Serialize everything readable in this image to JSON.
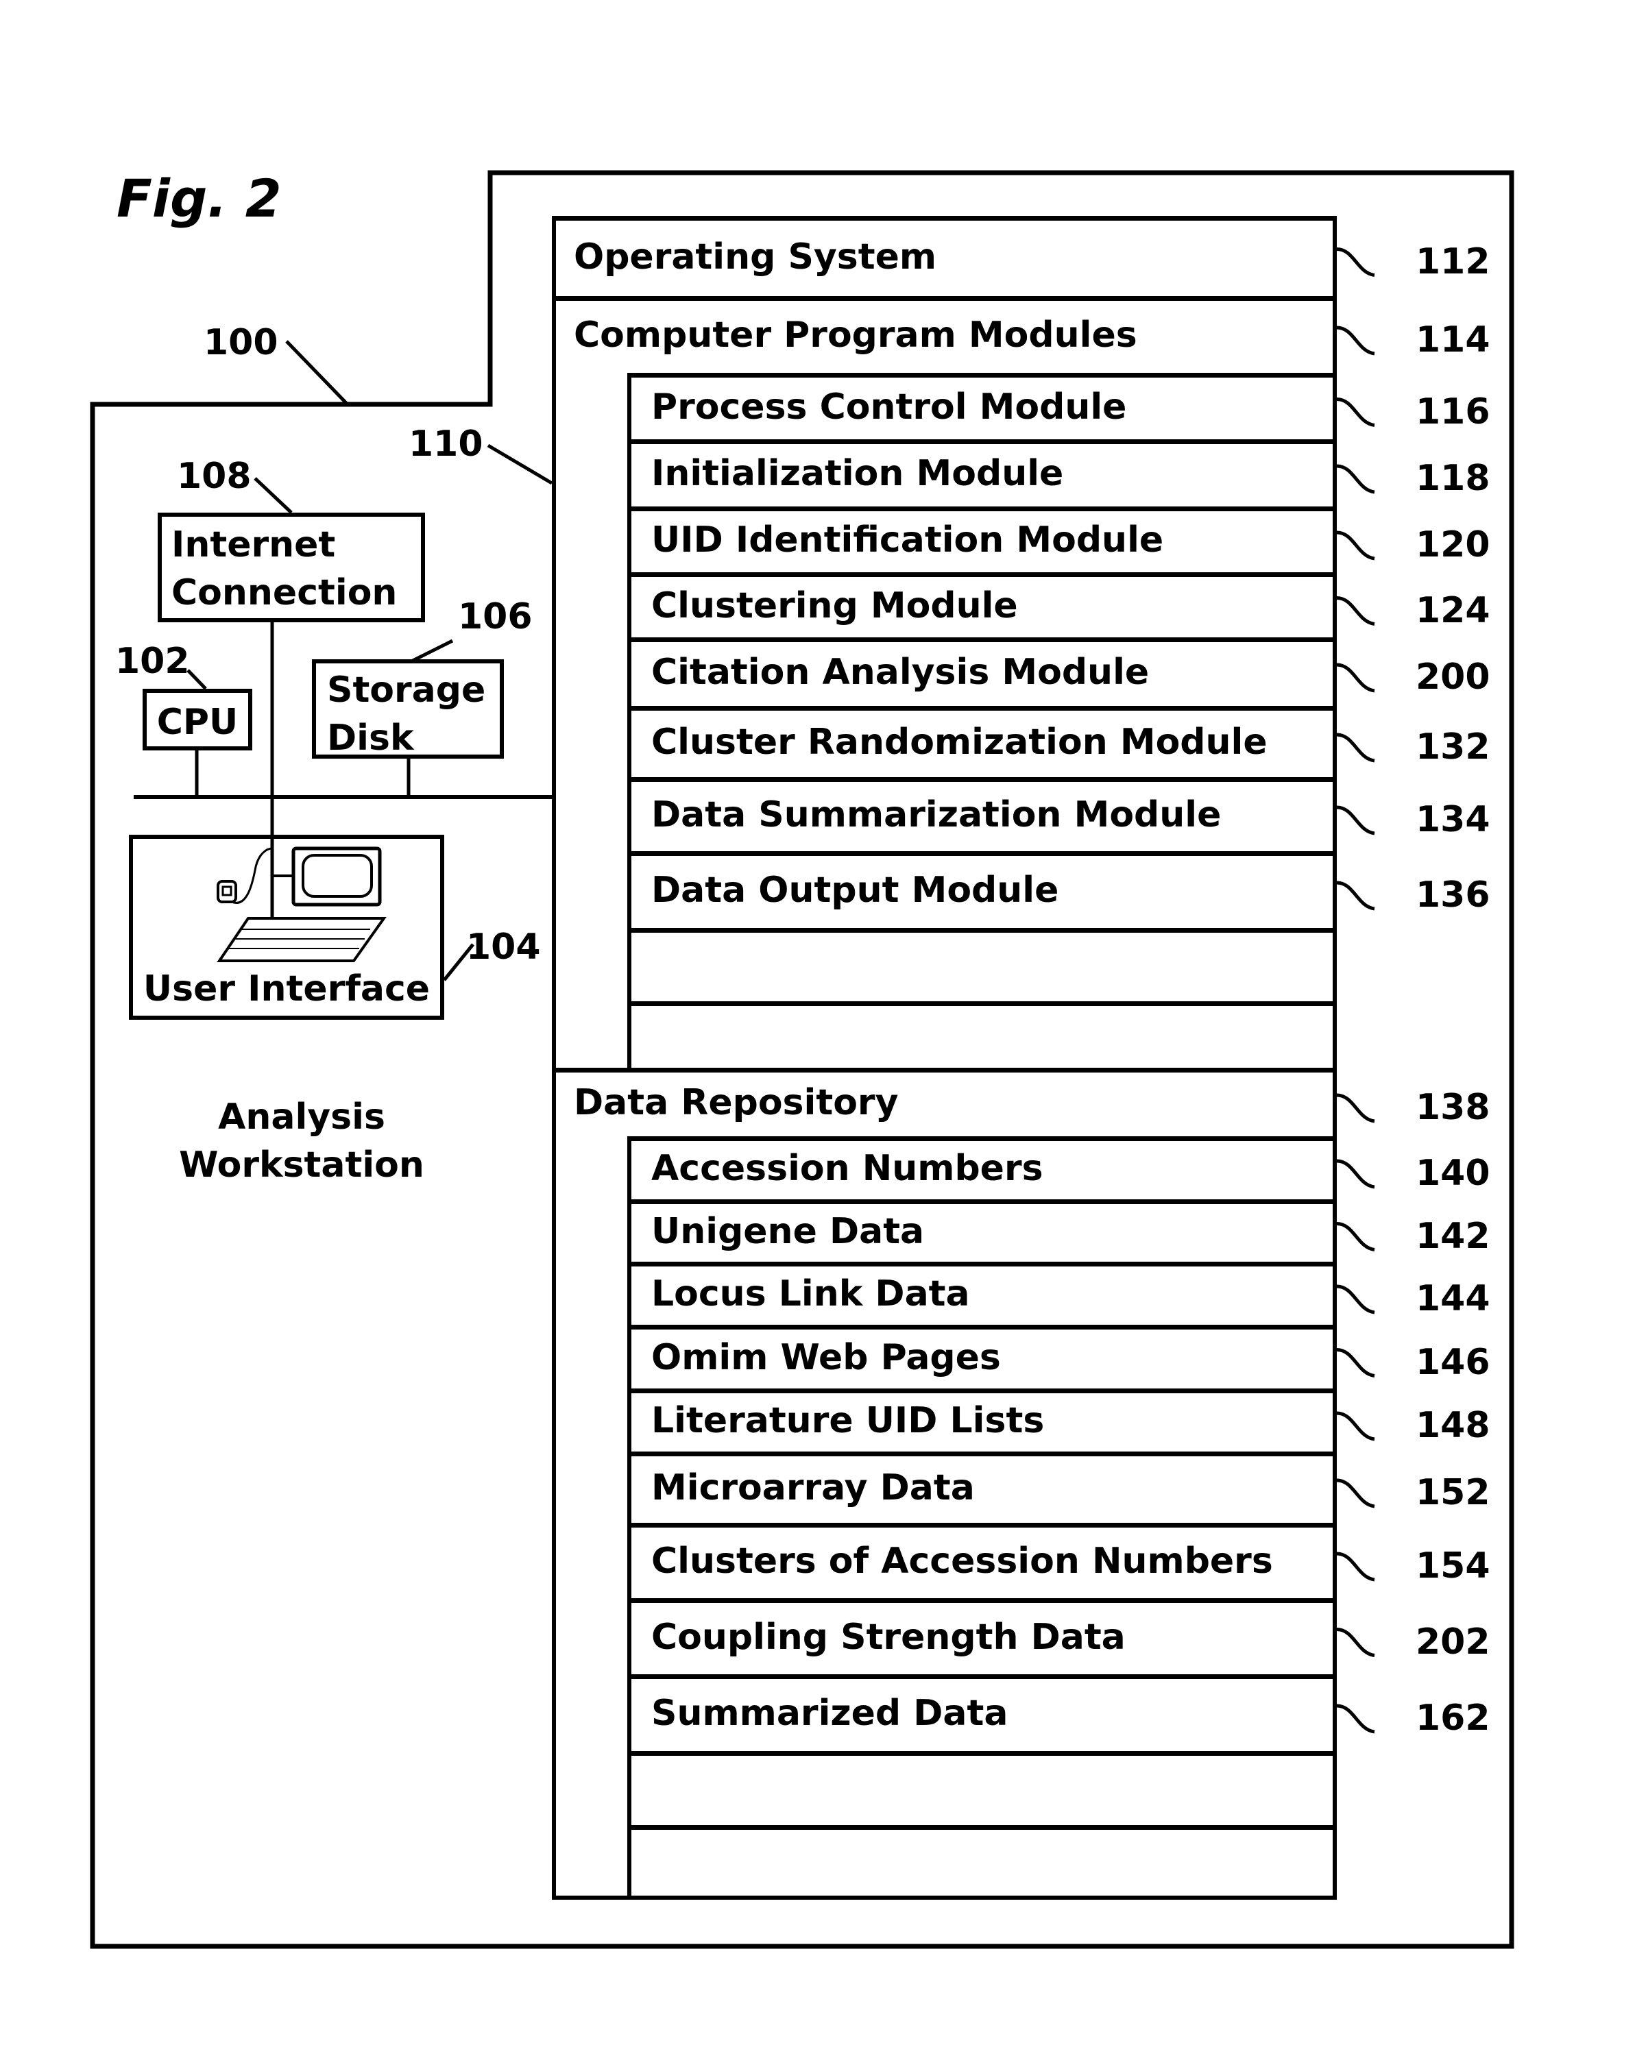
{
  "figure": {
    "title": "Fig. 2",
    "workstation_label": "Analysis Workstation",
    "workstation_ref": "100",
    "memory_ref": "110"
  },
  "hardware": {
    "internet": {
      "label": "Internet Connection",
      "ref": "108"
    },
    "cpu": {
      "label": "CPU",
      "ref": "102"
    },
    "storage": {
      "label": "Storage Disk",
      "ref": "106"
    },
    "user_interface": {
      "label": "User Interface",
      "ref": "104"
    }
  },
  "memory": {
    "top_rows": [
      {
        "label": "Operating System",
        "ref": "112"
      },
      {
        "label": "Computer Program Modules",
        "ref": "114"
      }
    ],
    "modules": [
      {
        "label": "Process Control Module",
        "ref": "116"
      },
      {
        "label": "Initialization Module",
        "ref": "118"
      },
      {
        "label": "UID Identification Module",
        "ref": "120"
      },
      {
        "label": "Clustering Module",
        "ref": "124"
      },
      {
        "label": "Citation Analysis Module",
        "ref": "200"
      },
      {
        "label": "Cluster Randomization Module",
        "ref": "132"
      },
      {
        "label": "Data Summarization Module",
        "ref": "134"
      },
      {
        "label": "Data Output Module",
        "ref": "136"
      },
      {
        "label": "",
        "ref": ""
      },
      {
        "label": "",
        "ref": ""
      }
    ],
    "repository": {
      "label": "Data Repository",
      "ref": "138"
    },
    "data_items": [
      {
        "label": "Accession Numbers",
        "ref": "140"
      },
      {
        "label": "Unigene Data",
        "ref": "142"
      },
      {
        "label": "Locus Link Data",
        "ref": "144"
      },
      {
        "label": "Omim Web Pages",
        "ref": "146"
      },
      {
        "label": "Literature UID Lists",
        "ref": "148"
      },
      {
        "label": "Microarray Data",
        "ref": "152"
      },
      {
        "label": "Clusters of Accession Numbers",
        "ref": "154"
      },
      {
        "label": "Coupling Strength Data",
        "ref": "202"
      },
      {
        "label": "Summarized Data",
        "ref": "162"
      },
      {
        "label": "",
        "ref": ""
      },
      {
        "label": "",
        "ref": ""
      }
    ]
  }
}
